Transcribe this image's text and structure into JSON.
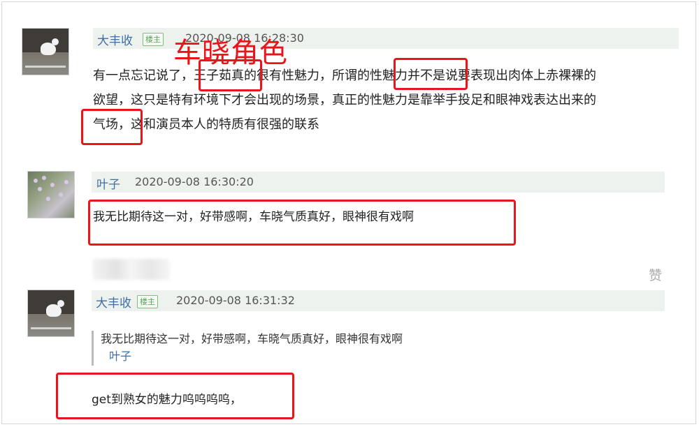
{
  "annotation": "车晓角色",
  "comments": [
    {
      "user": "大丰收",
      "badge": "楼主",
      "timestamp": "2020-09-08 16:28:30",
      "text_lines": [
        "有一点忘记说了，王子茹真的很有性魅力，所谓的性魅力并不是说要表现出肉体上赤裸裸的",
        "欲望，这只是特有环境下才会出现的场景，真正的性魅力是靠举手投足和眼神戏表达出来的",
        "气场，这和演员本人的特质有很强的联系"
      ]
    },
    {
      "user": "叶子",
      "timestamp": "2020-09-08 16:30:20",
      "text": "我无比期待这一对，好带感啊，车晓气质真好，眼神很有戏啊",
      "like_label": "赞"
    },
    {
      "user": "大丰收",
      "badge": "楼主",
      "timestamp": "2020-09-08 16:31:32",
      "quote": {
        "text": "我无比期待这一对，好带感啊，车晓气质真好，眼神很有戏啊",
        "author": "叶子"
      },
      "text": "get到熟女的魅力呜呜呜呜，"
    }
  ],
  "colors": {
    "annotation_red": "#e8151b",
    "username_blue": "#3f6ea8",
    "header_bg": "#eef2ee"
  }
}
